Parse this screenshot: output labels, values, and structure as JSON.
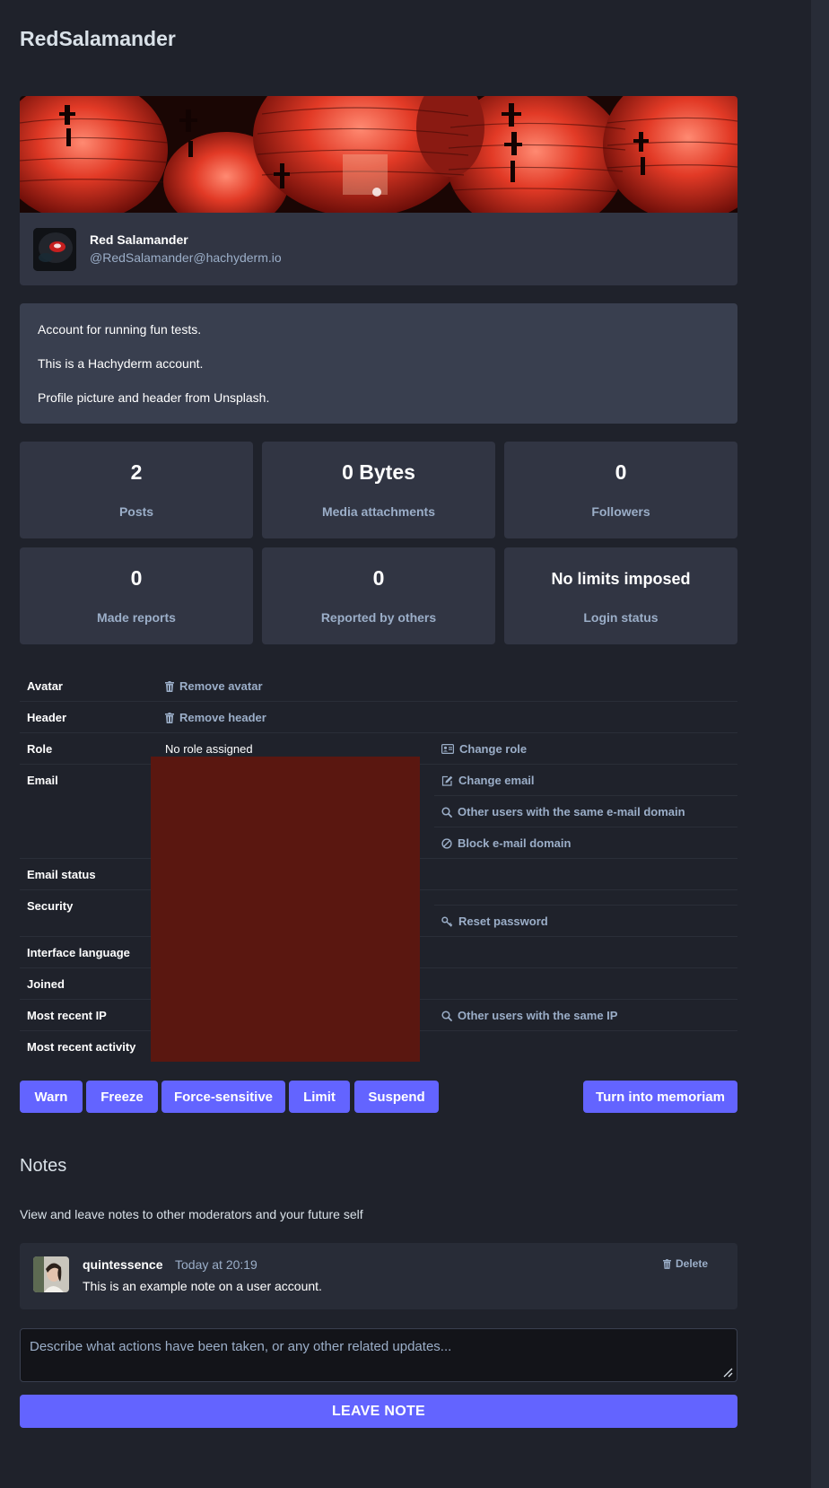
{
  "page": {
    "title": "RedSalamander"
  },
  "profile": {
    "display_name": "Red Salamander",
    "handle": "@RedSalamander@hachyderm.io",
    "bio": [
      "Account for running fun tests.",
      "This is a Hachyderm account.",
      "Profile picture and header from Unsplash."
    ]
  },
  "stats": [
    {
      "value": "2",
      "label": "Posts"
    },
    {
      "value": "0 Bytes",
      "label": "Media attachments"
    },
    {
      "value": "0",
      "label": "Followers"
    },
    {
      "value": "0",
      "label": "Made reports"
    },
    {
      "value": "0",
      "label": "Reported by others"
    },
    {
      "value": "No limits imposed",
      "label": "Login status"
    }
  ],
  "details": {
    "avatar": {
      "label": "Avatar",
      "action": "Remove avatar"
    },
    "header": {
      "label": "Header",
      "action": "Remove header"
    },
    "role": {
      "label": "Role",
      "value": "No role assigned",
      "action": "Change role"
    },
    "email": {
      "label": "Email",
      "actions": [
        "Change email",
        "Other users with the same e-mail domain",
        "Block e-mail domain"
      ]
    },
    "email_status": {
      "label": "Email status"
    },
    "security": {
      "label": "Security",
      "action": "Reset password"
    },
    "interface_language": {
      "label": "Interface language"
    },
    "joined": {
      "label": "Joined"
    },
    "recent_ip": {
      "label": "Most recent IP",
      "action": "Other users with the same IP"
    },
    "recent_activity": {
      "label": "Most recent activity"
    }
  },
  "actions": {
    "warn": "Warn",
    "freeze": "Freeze",
    "sensitive": "Force-sensitive",
    "limit": "Limit",
    "suspend": "Suspend",
    "memoriam": "Turn into memoriam"
  },
  "notes": {
    "title": "Notes",
    "description": "View and leave notes to other moderators and your future self",
    "items": [
      {
        "author": "quintessence",
        "time": "Today at 20:19",
        "text": "This is an example note on a user account.",
        "delete_label": "Delete"
      }
    ],
    "placeholder": "Describe what actions have been taken, or any other related updates...",
    "submit_label": "LEAVE NOTE"
  },
  "colors": {
    "background": "#1f222b",
    "panel": "#313543",
    "accent": "#6364ff",
    "muted_text": "#9baec8",
    "redaction": "#5a1710"
  },
  "icons": [
    "trash-icon",
    "id-card-icon",
    "pencil-square-icon",
    "search-icon",
    "ban-icon",
    "key-icon",
    "resize-handle-icon"
  ]
}
